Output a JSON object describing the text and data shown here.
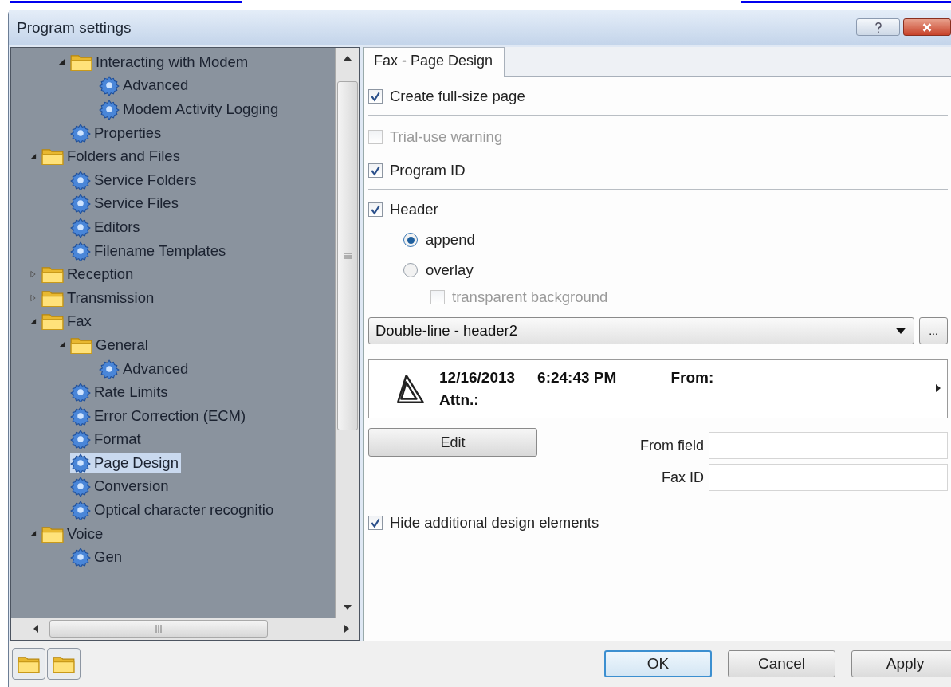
{
  "window": {
    "title": "Program settings"
  },
  "tree": {
    "continued_items": [
      {
        "label": "Interacting with Modem",
        "kind": "folder",
        "expanded": true,
        "selected": false,
        "children": [
          {
            "label": "Advanced",
            "kind": "page",
            "selected": false
          },
          {
            "label": "Modem Activity Logging",
            "kind": "page",
            "selected": false
          }
        ]
      },
      {
        "label": "Properties",
        "kind": "page",
        "selected": false
      }
    ],
    "items": [
      {
        "label": "Folders and Files",
        "kind": "folder",
        "expanded": true,
        "selected": false,
        "children": [
          {
            "label": "Service Folders",
            "kind": "page",
            "selected": false
          },
          {
            "label": "Service Files",
            "kind": "page",
            "selected": false
          },
          {
            "label": "Editors",
            "kind": "page",
            "selected": false
          },
          {
            "label": "Filename Templates",
            "kind": "page",
            "selected": false
          }
        ]
      },
      {
        "label": "Reception",
        "kind": "folder",
        "expanded": false,
        "selected": false
      },
      {
        "label": "Transmission",
        "kind": "folder",
        "expanded": false,
        "selected": false
      },
      {
        "label": "Fax",
        "kind": "folder",
        "expanded": true,
        "selected": false,
        "children": [
          {
            "label": "General",
            "kind": "folder",
            "expanded": true,
            "selected": false,
            "children": [
              {
                "label": "Advanced",
                "kind": "page",
                "selected": false
              }
            ]
          },
          {
            "label": "Rate Limits",
            "kind": "page",
            "selected": false
          },
          {
            "label": "Error Correction (ECM)",
            "kind": "page",
            "selected": false
          },
          {
            "label": "Format",
            "kind": "page",
            "selected": false
          },
          {
            "label": "Page Design",
            "kind": "page",
            "selected": true
          },
          {
            "label": "Conversion",
            "kind": "page",
            "selected": false
          },
          {
            "label": "Optical character recognitio",
            "kind": "page",
            "selected": false
          }
        ]
      },
      {
        "label": "Voice",
        "kind": "folder",
        "expanded": true,
        "selected": false,
        "children": [
          {
            "label": "Gen",
            "kind": "page",
            "selected": false
          }
        ]
      }
    ]
  },
  "tab": {
    "label": "Fax - Page Design",
    "selected": true
  },
  "create_full_size": {
    "label": "Create full-size page",
    "checked": true,
    "disabled": false
  },
  "trial_warning": {
    "label": "Trial-use warning",
    "checked": false,
    "disabled": true
  },
  "program_id": {
    "label": "Program ID",
    "checked": true,
    "disabled": false
  },
  "header": {
    "label": "Header",
    "checked": true,
    "disabled": false,
    "modes": [
      {
        "label": "append",
        "selected": true
      },
      {
        "label": "overlay",
        "selected": false
      }
    ],
    "transparent": {
      "label": "transparent background",
      "checked": false,
      "disabled": true
    }
  },
  "template_select": {
    "value": "Double-line - header2"
  },
  "more_button": {
    "label": "..."
  },
  "preview": {
    "date": "12/16/2013",
    "time": "6:24:43 PM",
    "from": "From:",
    "attn": "Attn.:"
  },
  "edit_button": {
    "label": "Edit"
  },
  "fields": [
    {
      "label": "From field"
    },
    {
      "label": "Fax ID"
    }
  ],
  "hide_elements": {
    "label": "Hide additional design elements",
    "checked": true,
    "disabled": false
  },
  "footer_buttons": [
    {
      "label": "OK",
      "default": true
    },
    {
      "label": "Cancel",
      "default": false
    },
    {
      "label": "Apply",
      "default": false
    }
  ]
}
